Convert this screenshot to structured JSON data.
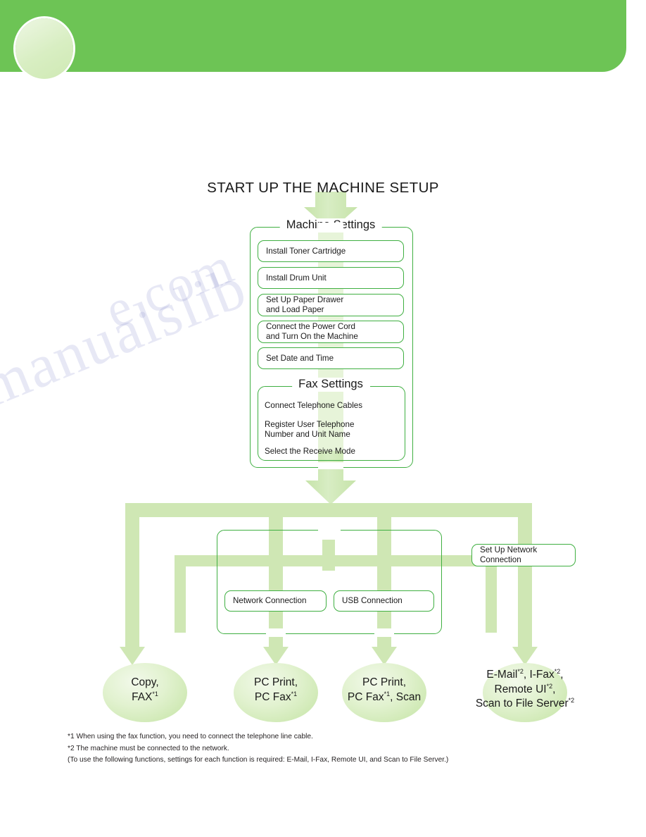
{
  "page": {
    "title": "START UP THE MACHINE SETUP",
    "accent_green": "#6dc455",
    "frame_green": "#3faf41",
    "arrow_green": "#cfe7b4"
  },
  "machine_settings": {
    "legend": "Machine Settings",
    "steps": [
      {
        "line1": "Install Toner Cartridge",
        "line2": ""
      },
      {
        "line1": "Install Drum Unit",
        "line2": ""
      },
      {
        "line1": "Set Up Paper Drawer",
        "line2": "and Load Paper"
      },
      {
        "line1": "Connect the Power Cord",
        "line2": "and Turn On the Machine"
      },
      {
        "line1": "Set Date and Time",
        "line2": ""
      }
    ]
  },
  "fax_settings": {
    "legend": "Fax Settings",
    "steps": [
      {
        "line1": "Connect Telephone Cables",
        "line2": ""
      },
      {
        "line1": "Register User Telephone",
        "line2": "Number and Unit Name"
      },
      {
        "line1": "Select the Receive Mode",
        "line2": ""
      }
    ]
  },
  "connection_group": {
    "network": "Network Connection",
    "usb": "USB Connection"
  },
  "network_setup": {
    "line1": "Set Up Network",
    "line2": "Connection"
  },
  "results": [
    {
      "id": "copy-fax",
      "lines": [
        "Copy,",
        "FAX*1"
      ]
    },
    {
      "id": "pc-print-pc-fax",
      "lines": [
        "PC Print,",
        "PC Fax*1"
      ]
    },
    {
      "id": "pc-print-pc-fax-scan",
      "lines": [
        "PC Print,",
        "PC Fax*1, Scan"
      ]
    },
    {
      "id": "email-ifax-remoteui-scan",
      "lines": [
        "E-Mail*2, I-Fax*2,",
        "Remote UI*2,",
        "Scan to File Server*2"
      ]
    }
  ],
  "footnotes": [
    "*1 When using the fax function, you need to connect the telephone line cable.",
    "*2 The machine must be connected to the network.",
    "(To use the following functions, settings for each function is required: E-Mail, I-Fax, Remote UI, and Scan to File Server.)"
  ],
  "watermark": {
    "line1": "manualslib",
    "line2": "e.com"
  }
}
